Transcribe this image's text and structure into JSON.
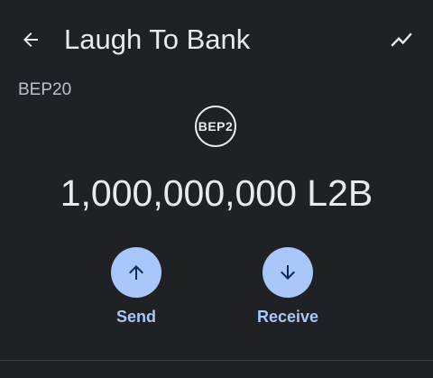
{
  "app_bar": {
    "title": "Laugh To Bank",
    "back_icon": "arrow-left-icon",
    "chart_icon": "trending-chart-icon"
  },
  "token": {
    "network": "BEP20",
    "logo_text": "BEP2",
    "balance": "1,000,000,000 L2B"
  },
  "actions": {
    "send": {
      "label": "Send",
      "icon": "arrow-up-icon"
    },
    "receive": {
      "label": "Receive",
      "icon": "arrow-down-icon"
    }
  },
  "colors": {
    "background": "#202124",
    "text_primary": "#e8eaed",
    "text_secondary": "#bdc1c6",
    "accent": "#a8c7fa",
    "accent_icon": "#0b2a55",
    "divider": "#3c4043"
  }
}
